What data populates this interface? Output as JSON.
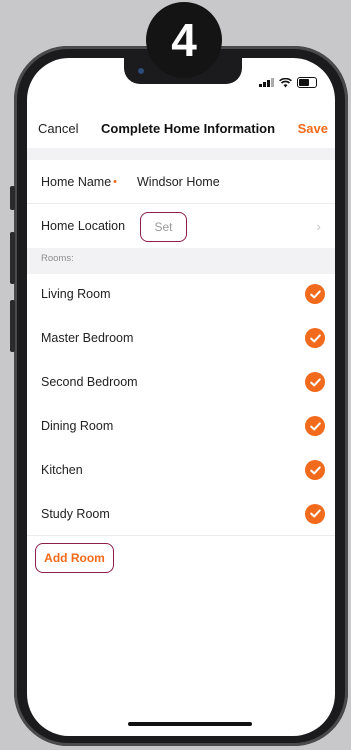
{
  "step_badge": "4",
  "nav": {
    "cancel_label": "Cancel",
    "title": "Complete Home Information",
    "save_label": "Save"
  },
  "form": {
    "home_name_label": "Home Name",
    "required_marker": "•",
    "home_name_value": "Windsor Home",
    "home_location_label": "Home Location",
    "home_location_value": "Set",
    "chevron": "›"
  },
  "rooms": {
    "section_label": "Rooms:",
    "items": [
      {
        "name": "Living Room",
        "checked": true
      },
      {
        "name": "Master Bedroom",
        "checked": true
      },
      {
        "name": "Second Bedroom",
        "checked": true
      },
      {
        "name": "Dining Room",
        "checked": true
      },
      {
        "name": "Kitchen",
        "checked": true
      },
      {
        "name": "Study Room",
        "checked": true
      }
    ],
    "add_room_label": "Add Room"
  },
  "colors": {
    "accent": "#f26a1b",
    "highlight_outline": "#8c1e4a",
    "section_bg": "#f2f2f4"
  },
  "icons": {
    "status": [
      "signal-icon",
      "wifi-icon",
      "battery-icon"
    ],
    "check": "check-icon"
  }
}
